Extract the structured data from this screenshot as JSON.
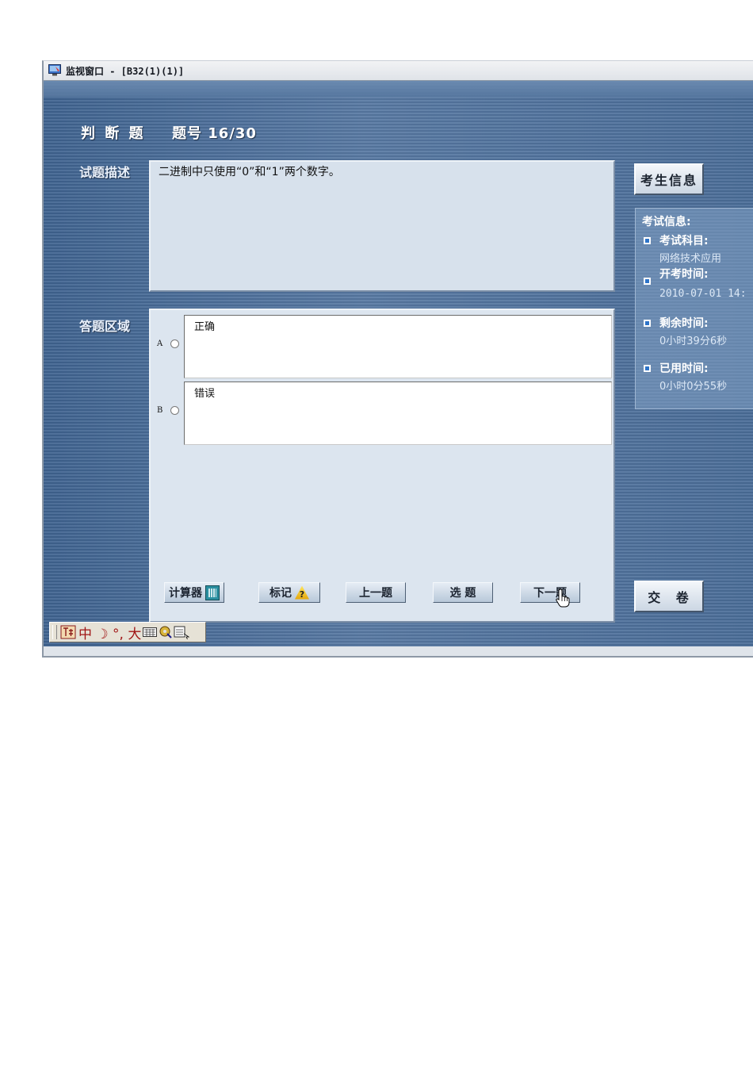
{
  "window": {
    "title": "监视窗口 - [B32(1)(1)]"
  },
  "question": {
    "type_label": "判 断 题",
    "number_label": "题号 16/30",
    "section_label": "试题描述",
    "text": "二进制中只使用“0”和“1”两个数字。"
  },
  "answer": {
    "section_label": "答题区域",
    "options": [
      {
        "letter": "A",
        "text": "正确",
        "selected": false
      },
      {
        "letter": "B",
        "text": "错误",
        "selected": false
      }
    ]
  },
  "toolbar": {
    "calculator_label": "计算器",
    "mark_label": "标记",
    "prev_label": "上一题",
    "select_label": "选 题",
    "next_label": "下一题"
  },
  "side": {
    "student_info_label": "考生信息",
    "submit_label": "交  卷"
  },
  "exam_info": {
    "title": "考试信息:",
    "subject_label": "考试科目:",
    "subject_value": "网络技术应用",
    "start_label": "开考时间:",
    "start_value": "2010-07-01 14:",
    "remaining_label": "剩余时间:",
    "remaining_value": "0小时39分6秒",
    "used_label": "已用时间:",
    "used_value": "0小时0分55秒"
  },
  "ime": {
    "text": "中 ☽ °, 大"
  },
  "colors": {
    "background": "#4a6e99",
    "panel": "#d7e1ec",
    "bullet": "#2e74c8"
  }
}
